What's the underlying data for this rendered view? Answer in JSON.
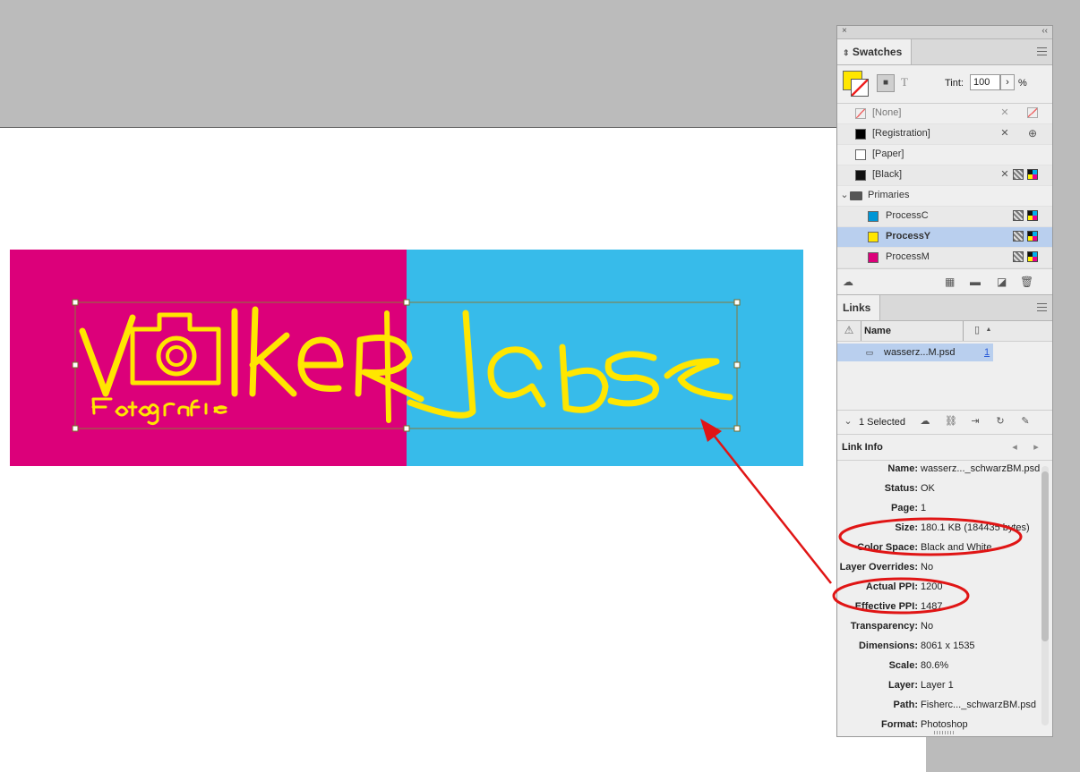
{
  "window": {
    "close_glyph": "×",
    "collapse_glyph": "‹‹"
  },
  "swatches": {
    "tab_label": "Swatches",
    "tint_label": "Tint:",
    "tint_value": "100",
    "tint_unit": "%",
    "items": [
      {
        "name": "[None]"
      },
      {
        "name": "[Registration]"
      },
      {
        "name": "[Paper]"
      },
      {
        "name": "[Black]"
      }
    ],
    "group": {
      "name": "Primaries",
      "items": [
        {
          "name": "ProcessC",
          "color": "#0096d6"
        },
        {
          "name": "ProcessY",
          "color": "#ffe600"
        },
        {
          "name": "ProcessM",
          "color": "#dc007a"
        }
      ]
    }
  },
  "links": {
    "tab_label": "Links",
    "column_name": "Name",
    "file_name": "wasserz...M.psd",
    "page_link": "1",
    "selected_count": "1 Selected",
    "info_title": "Link Info",
    "info": [
      {
        "k": "Name:",
        "v": "wasserz..._schwarzBM.psd"
      },
      {
        "k": "Status:",
        "v": "OK"
      },
      {
        "k": "Page:",
        "v": "1"
      },
      {
        "k": "Size:",
        "v": "180.1 KB (184435 bytes)"
      },
      {
        "k": "Color Space:",
        "v": "Black and White"
      },
      {
        "k": "Layer Overrides:",
        "v": "No"
      },
      {
        "k": "Actual PPI:",
        "v": "1200"
      },
      {
        "k": "Effective PPI:",
        "v": "1487"
      },
      {
        "k": "Transparency:",
        "v": "No"
      },
      {
        "k": "Dimensions:",
        "v": "8061 x 1535"
      },
      {
        "k": "Scale:",
        "v": "80.6%"
      },
      {
        "k": "Layer:",
        "v": "Layer 1"
      },
      {
        "k": "Path:",
        "v": "Fisherc..._schwarzBM.psd"
      },
      {
        "k": "Format:",
        "v": "Photoshop"
      }
    ]
  },
  "colors": {
    "magenta": "#dc007a",
    "cyan": "#37bbea",
    "logo_yellow": "#ffe600",
    "annotation_red": "#e01515",
    "selection_blue": "#b9cfee"
  }
}
